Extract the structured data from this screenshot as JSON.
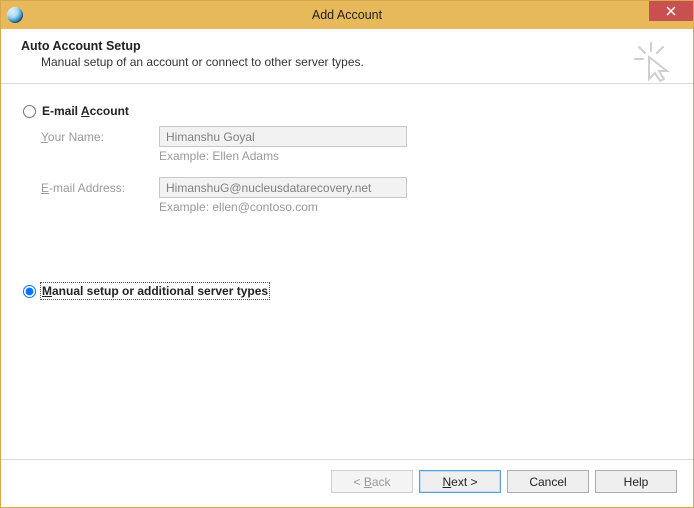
{
  "window": {
    "title": "Add Account"
  },
  "header": {
    "title": "Auto Account Setup",
    "subtitle": "Manual setup of an account or connect to other server types."
  },
  "radios": {
    "email_prefix": "E-mail ",
    "email_uchar": "A",
    "email_suffix": "ccount",
    "manual_uchar": "M",
    "manual_suffix": "anual setup or additional server types"
  },
  "form": {
    "name_label_prefix": "",
    "name_label_uchar": "Y",
    "name_label_suffix": "our Name:",
    "name_value": "Himanshu Goyal",
    "name_example": "Example: Ellen Adams",
    "email_label_prefix": "",
    "email_label_uchar": "E",
    "email_label_suffix": "-mail Address:",
    "email_value": "HimanshuG@nucleusdatarecovery.net",
    "email_example": "Example: ellen@contoso.com"
  },
  "buttons": {
    "back_prefix": "< ",
    "back_uchar": "B",
    "back_suffix": "ack",
    "next_uchar": "N",
    "next_suffix": "ext >",
    "cancel": "Cancel",
    "help": "Help"
  }
}
